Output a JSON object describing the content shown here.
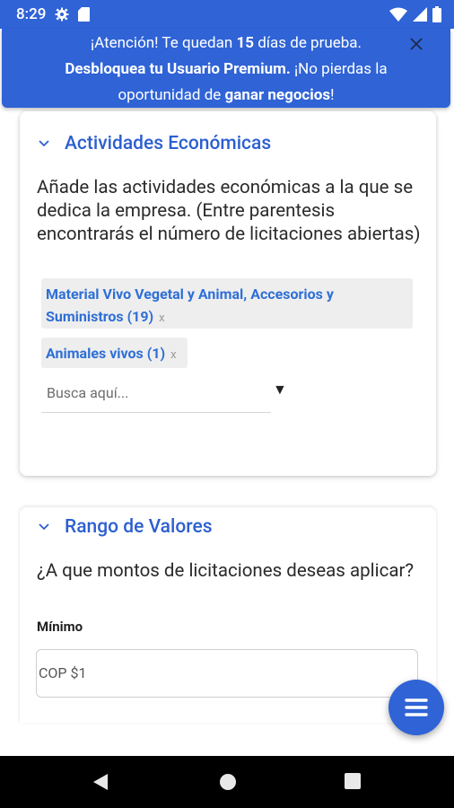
{
  "status_bar": {
    "time": "8:29",
    "icons": [
      "gear-icon",
      "sd-card-icon",
      "wifi-icon",
      "signal-icon",
      "battery-icon"
    ]
  },
  "banner": {
    "line1_a": "¡Atención! Te quedan ",
    "line1_b": "15",
    "line1_c": " días de prueba.",
    "line2_a": "Desbloquea tu Usuario Premium.",
    "line2_b": " ¡No pierdas la",
    "line3_a": "oportunidad de ",
    "line3_b": "ganar negocios",
    "line3_c": "!"
  },
  "activities": {
    "title": "Actividades Económicas",
    "description": "Añade las actividades económicas a la que se dedica la empresa. (Entre parentesis encontrarás el número de licitaciones abiertas)",
    "chips": [
      {
        "label": "Material Vivo Vegetal y Animal, Accesorios y Suministros (19)",
        "remove": "x"
      },
      {
        "label": "Animales vivos (1)",
        "remove": "x"
      }
    ],
    "search_placeholder": "Busca aquí...",
    "dropdown_arrow": "▼"
  },
  "value_range": {
    "title": "Rango de Valores",
    "question": "¿A que montos de licitaciones deseas aplicar?",
    "min_label": "Mínimo",
    "min_value": "COP $1"
  },
  "colors": {
    "accent": "#2f63d6",
    "title_blue": "#2c5fd0",
    "chip_text": "#2e6fd6"
  }
}
